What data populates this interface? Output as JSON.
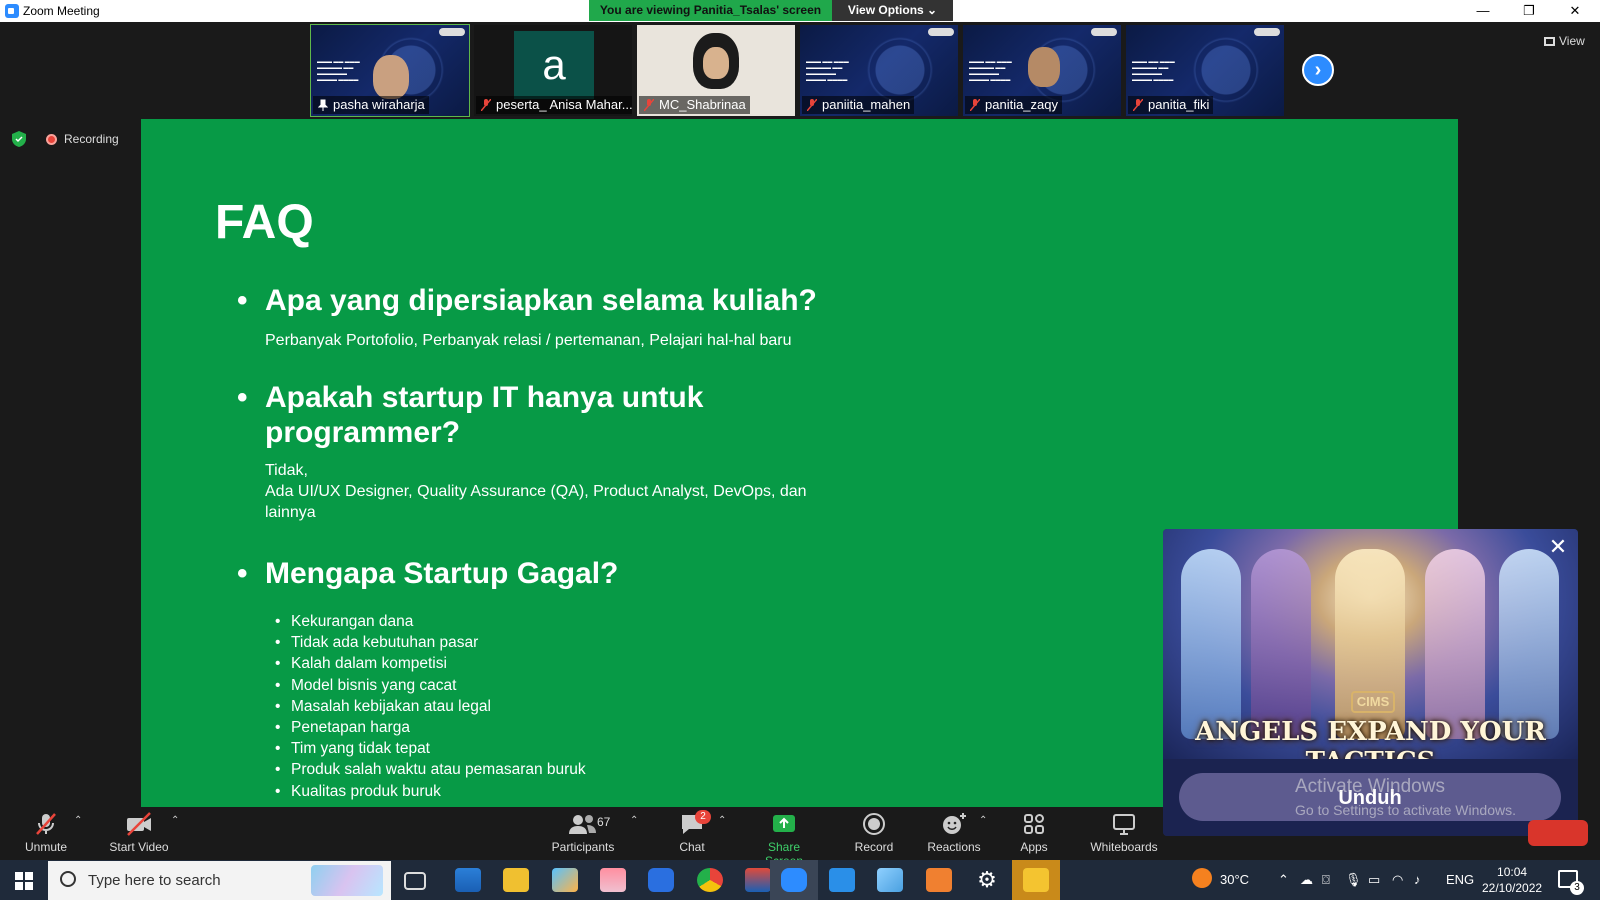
{
  "window": {
    "title": "Zoom Meeting",
    "viewing_banner": "You are viewing Panitia_Tsalas' screen",
    "view_options": "View Options ⌄",
    "controls": [
      "—",
      "❐",
      "✕"
    ]
  },
  "participants": [
    {
      "name": "pasha wiraharja",
      "mic": "pinned",
      "kind": "video"
    },
    {
      "name": "peserta_ Anisa Mahar...",
      "mic": "muted",
      "kind": "avatar",
      "initial": "a"
    },
    {
      "name": "MC_Shabrinaa",
      "mic": "muted",
      "kind": "video"
    },
    {
      "name": "paniitia_mahen",
      "mic": "muted",
      "kind": "slide"
    },
    {
      "name": "panitia_zaqy",
      "mic": "muted",
      "kind": "video"
    },
    {
      "name": "panitia_fiki",
      "mic": "muted",
      "kind": "slide"
    }
  ],
  "view_button": "View",
  "recording_label": "Recording",
  "slide": {
    "title": "FAQ",
    "q1": "Apa yang dipersiapkan selama kuliah?",
    "a1": "Perbanyak Portofolio, Perbanyak relasi / pertemanan,  Pelajari hal-hal baru",
    "q2_line1": "Apakah startup IT hanya untuk",
    "q2_line2": "programmer?",
    "a2_line1": "Tidak,",
    "a2_line2": "Ada UI/UX Designer, Quality Assurance (QA), Product Analyst, DevOps, dan",
    "a2_line3": "lainnya",
    "q3": "Mengapa Startup Gagal?",
    "reasons": [
      "Kekurangan dana",
      "Tidak ada kebutuhan pasar",
      "Kalah dalam kompetisi",
      "Model bisnis yang cacat",
      "Masalah kebijakan atau legal",
      "Penetapan harga",
      "Tim yang tidak tepat",
      "Produk salah waktu atau pemasaran buruk",
      "Kualitas produk buruk"
    ]
  },
  "ad": {
    "logo": "CIMS",
    "headline": "ANGELS EXPAND YOUR TACTICS",
    "cta": "Unduh",
    "close": "✕"
  },
  "watermark": {
    "line1": "Activate Windows",
    "line2": "Go to Settings to activate Windows."
  },
  "toolbar": {
    "unmute": "Unmute",
    "start_video": "Start Video",
    "participants": "Participants",
    "participants_count": "67",
    "chat": "Chat",
    "chat_badge": "2",
    "share_screen": "Share Screen",
    "record": "Record",
    "reactions": "Reactions",
    "apps": "Apps",
    "whiteboards": "Whiteboards"
  },
  "taskbar": {
    "search_placeholder": "Type here to search",
    "weather": "30°C",
    "language": "ENG",
    "time": "10:04",
    "date": "22/10/2022",
    "notifications": "3"
  },
  "colors": {
    "slide_bg": "#079a46",
    "banner_green": "#20a84b",
    "zoom_blue": "#2d8cff",
    "record_red": "#e8443a"
  }
}
